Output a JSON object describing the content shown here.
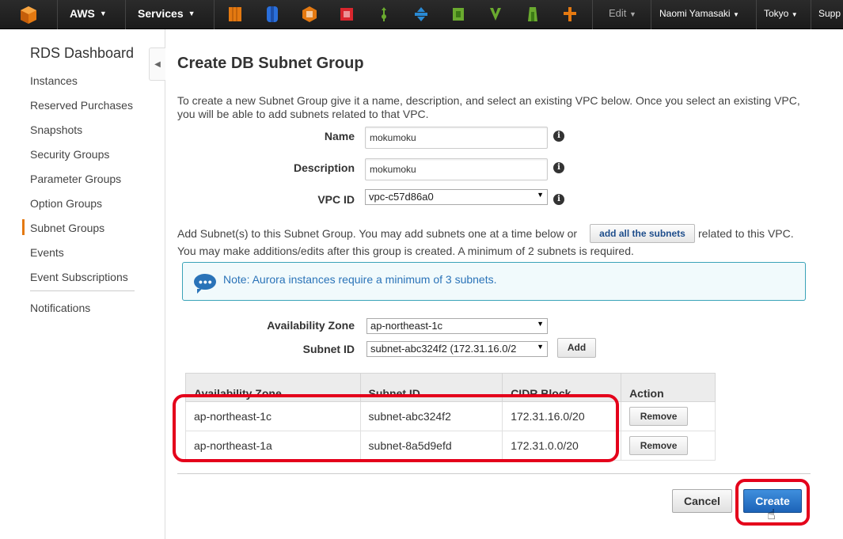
{
  "topbar": {
    "brand": "AWS",
    "services": "Services",
    "edit": "Edit",
    "user": "Naomi Yamasaki",
    "region": "Tokyo",
    "support": "Supp",
    "service_icons": [
      "ec2-icon",
      "s3-icon",
      "cloudformation-icon",
      "codedeploy-icon",
      "elasticbeanstalk-icon",
      "swf-icon",
      "opsworks-icon",
      "lambda-icon",
      "cloudtrail-icon",
      "ses-icon"
    ],
    "colors": {
      "bar": "#1b1b1b",
      "orange": "#e47911"
    }
  },
  "sidebar": {
    "title": "RDS Dashboard",
    "items": [
      "Instances",
      "Reserved Purchases",
      "Snapshots",
      "Security Groups",
      "Parameter Groups",
      "Option Groups",
      "Subnet Groups",
      "Events",
      "Event Subscriptions",
      "Notifications"
    ],
    "active": "Subnet Groups"
  },
  "page": {
    "title": "Create DB Subnet Group",
    "intro": "To create a new Subnet Group give it a name, description, and select an existing VPC below. Once you select an existing VPC, you will be able to add subnets related to that VPC.",
    "name_label": "Name",
    "name_value": "mokumoku",
    "description_label": "Description",
    "description_value": "mokumoku",
    "vpc_label": "VPC ID",
    "vpc_value": "vpc-c57d86a0",
    "add_text_before": "Add Subnet(s) to this Subnet Group. You may add subnets one at a time below or",
    "add_all_button": "add all the subnets",
    "add_text_after": "related to this VPC.",
    "add_text_line2": "You may make additions/edits after this group is created. A minimum of 2 subnets is required.",
    "note": "Note: Aurora instances require a minimum of 3 subnets.",
    "az_label": "Availability Zone",
    "az_value": "ap-northeast-1c",
    "subnet_label": "Subnet ID",
    "subnet_value": "subnet-abc324f2 (172.31.16.0/2",
    "add_button": "Add",
    "table": {
      "headers": [
        "Availability Zone",
        "Subnet ID",
        "CIDR Block",
        "Action"
      ],
      "rows": [
        {
          "az": "ap-northeast-1c",
          "subnet": "subnet-abc324f2",
          "cidr": "172.31.16.0/20",
          "action": "Remove"
        },
        {
          "az": "ap-northeast-1a",
          "subnet": "subnet-8a5d9efd",
          "cidr": "172.31.0.0/20",
          "action": "Remove"
        }
      ]
    },
    "cancel_button": "Cancel",
    "create_button": "Create"
  }
}
